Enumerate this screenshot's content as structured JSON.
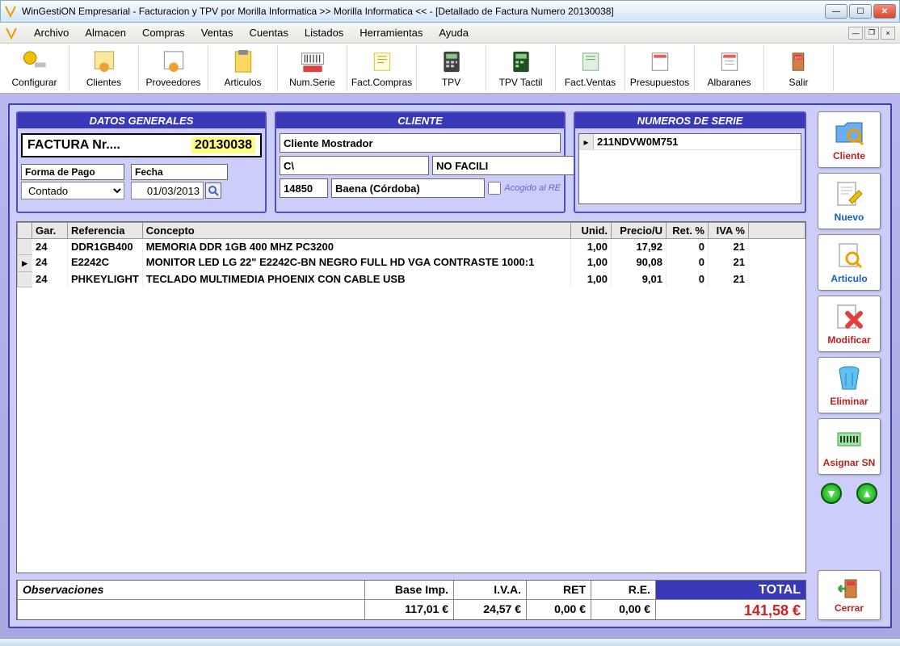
{
  "window": {
    "title": "WinGestiON Empresarial - Facturacion y TPV por Morilla Informatica >> Morilla Informatica << - [Detallado de Factura Numero 20130038]"
  },
  "menu": {
    "items": [
      "Archivo",
      "Almacen",
      "Compras",
      "Ventas",
      "Cuentas",
      "Listados",
      "Herramientas",
      "Ayuda"
    ]
  },
  "toolbar": [
    {
      "label": "Configurar"
    },
    {
      "label": "Clientes"
    },
    {
      "label": "Proveedores"
    },
    {
      "label": "Articulos"
    },
    {
      "label": "Num.Serie"
    },
    {
      "label": "Fact.Compras"
    },
    {
      "label": "TPV"
    },
    {
      "label": "TPV Tactil"
    },
    {
      "label": "Fact.Ventas"
    },
    {
      "label": "Presupuestos"
    },
    {
      "label": "Albaranes"
    },
    {
      "label": "Salir"
    }
  ],
  "panels": {
    "datos": {
      "title": "DATOS GENERALES",
      "factura_label": "FACTURA Nr....",
      "factura_num": "20130038",
      "forma_pago_label": "Forma de Pago",
      "forma_pago_value": "Contado",
      "fecha_label": "Fecha",
      "fecha_value": "01/03/2013"
    },
    "cliente": {
      "title": "CLIENTE",
      "nombre": "Cliente Mostrador",
      "direccion": "C\\",
      "nif": "NO FACILI",
      "cp": "14850",
      "localidad": "Baena (Córdoba)",
      "re_label": "Acogido al RE"
    },
    "serie": {
      "title": "NUMEROS DE SERIE",
      "rows": [
        "211NDVW0M751"
      ]
    }
  },
  "grid": {
    "headers": {
      "gar": "Gar.",
      "ref": "Referencia",
      "concepto": "Concepto",
      "unid": "Unid.",
      "precio": "Precio/U",
      "ret": "Ret. %",
      "iva": "IVA %"
    },
    "rows": [
      {
        "gar": "24",
        "ref": "DDR1GB400",
        "concepto": "MEMORIA DDR 1GB 400 MHZ PC3200",
        "unid": "1,00",
        "precio": "17,92",
        "ret": "0",
        "iva": "21",
        "active": false
      },
      {
        "gar": "24",
        "ref": "E2242C",
        "concepto": "MONITOR LED LG 22\" E2242C-BN NEGRO FULL HD VGA CONTRASTE 1000:1",
        "unid": "1,00",
        "precio": "90,08",
        "ret": "0",
        "iva": "21",
        "active": true
      },
      {
        "gar": "24",
        "ref": "PHKEYLIGHT",
        "concepto": "TECLADO MULTIMEDIA PHOENIX CON CABLE USB",
        "unid": "1,00",
        "precio": "9,01",
        "ret": "0",
        "iva": "21",
        "active": false
      }
    ]
  },
  "totals": {
    "obs_label": "Observaciones",
    "obs_value": "",
    "base_label": "Base Imp.",
    "base_value": "117,01 €",
    "iva_label": "I.V.A.",
    "iva_value": "24,57 €",
    "ret_label": "RET",
    "ret_value": "0,00 €",
    "re_label": "R.E.",
    "re_value": "0,00 €",
    "total_label": "TOTAL",
    "total_value": "141,58 €"
  },
  "actions": [
    {
      "label": "Cliente"
    },
    {
      "label": "Nuevo"
    },
    {
      "label": "Articulo"
    },
    {
      "label": "Modificar"
    },
    {
      "label": "Eliminar"
    },
    {
      "label": "Asignar SN"
    }
  ],
  "cerrar_label": "Cerrar"
}
